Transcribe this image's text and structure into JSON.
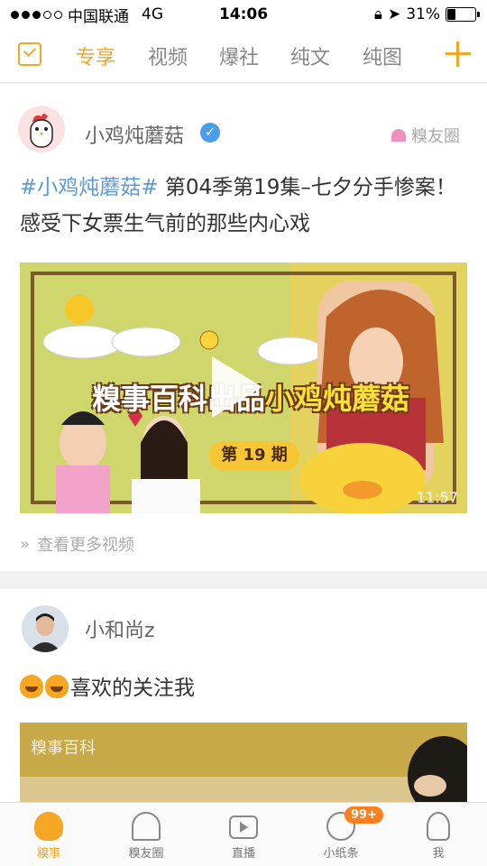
{
  "status_bar": {
    "carrier": "中国联通",
    "network": "4G",
    "time": "14:06",
    "battery": "31%",
    "battery_level": 0.31
  },
  "top_nav": {
    "tabs": [
      {
        "label": "专享",
        "active": true
      },
      {
        "label": "视频",
        "active": false
      },
      {
        "label": "爆社",
        "active": false
      },
      {
        "label": "纯文",
        "active": false
      },
      {
        "label": "纯图",
        "active": false
      }
    ],
    "accent_color": "#f5a623"
  },
  "feed": {
    "post1": {
      "username": "小鸡炖蘑菇",
      "verified_mark": "✓",
      "circle_tag": "糗友圈",
      "hashtag": "#小鸡炖蘑菇#",
      "text": "第04季第19集–七夕分手惨案！感受下女票生气前的那些内心戏",
      "video_banner_white": "糗事百科出品",
      "video_banner_yellow": "小鸡炖蘑菇",
      "episode": "第 19 期",
      "duration": "11:57",
      "more_videos": "查看更多视频"
    },
    "post2": {
      "username": "小和尚z",
      "text": "喜欢的关注我",
      "watermark": "糗事百科"
    }
  },
  "tabbar": {
    "items": [
      {
        "label": "糗事",
        "icon": "poop-icon",
        "active": true
      },
      {
        "label": "糗友圈",
        "icon": "circle-icon",
        "active": false
      },
      {
        "label": "直播",
        "icon": "tv-icon",
        "active": false
      },
      {
        "label": "小纸条",
        "icon": "chat-icon",
        "active": false,
        "badge": "99+"
      },
      {
        "label": "我",
        "icon": "profile-icon",
        "active": false
      }
    ]
  }
}
